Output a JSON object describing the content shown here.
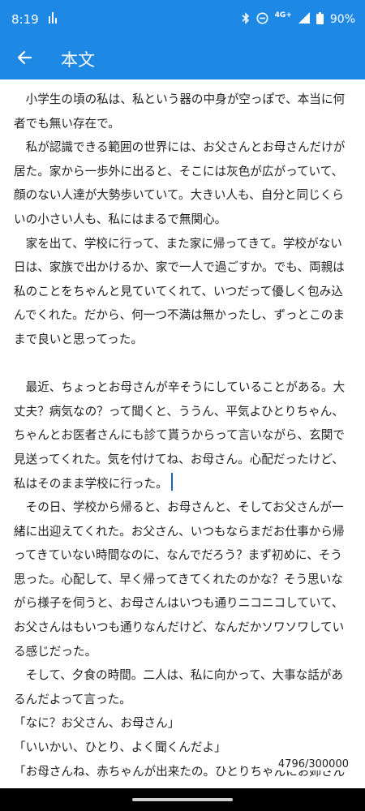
{
  "status": {
    "time": "8:19",
    "network": "4G+",
    "battery": "90%"
  },
  "header": {
    "title": "本文"
  },
  "paragraphs": [
    "小学生の頃の私は、私という器の中身が空っぽで、本当に何者でも無い存在で。",
    "私が認識できる範囲の世界には、お父さんとお母さんだけが居た。家から一歩外に出ると、そこには灰色が広がっていて、顔のない人達が大勢歩いていて。大きい人も、自分と同じくらいの小さい人も、私にはまるで無関心。",
    "家を出て、学校に行って、また家に帰ってきて。学校がない日は、家族で出かけるか、家で一人で過ごすか。でも、両親は私のことをちゃんと見ていてくれて、いつだって優しく包み込んでくれた。だから、何一つ不満は無かったし、ずっとこのままで良いと思ってった。",
    "",
    "最近、ちょっとお母さんが辛そうにしていることがある。大丈夫？病気なの？って聞くと、ううん、平気よひとりちゃん、ちゃんとお医者さんにも診て貰うからって言いながら、玄関で見送ってくれた。気を付けてね、お母さん。心配だったけど、私はそのまま学校に行った。",
    "その日、学校から帰ると、お母さんと、そしてお父さんが一緒に出迎えてくれた。お父さん、いつもならまだお仕事から帰ってきていない時間なのに、なんでだろう？まず初めに、そう思った。心配して、早く帰ってきてくれたのかな？そう思いながら様子を伺うと、お母さんはいつも通りニコニコしていて、お父さんはもいつも通りなんだけど、なんだかソワソワしている感じだった。",
    "そして、夕食の時間。二人は、私に向かって、大事な話があるんだよって言った。",
    "「なに？お父さん、お母さん」",
    "「いいかい、ひとり、よく聞くんだよ」",
    "「お母さんね、赤ちゃんが出来たの。ひとりちゃんにお姉さんに"
  ],
  "counter": "4796/300000"
}
